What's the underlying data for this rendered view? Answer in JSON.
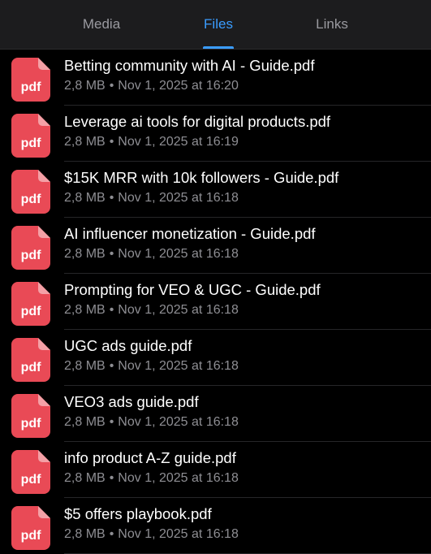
{
  "tabs": [
    {
      "label": "Media",
      "active": false
    },
    {
      "label": "Files",
      "active": true
    },
    {
      "label": "Links",
      "active": false
    }
  ],
  "colors": {
    "accent": "#3a9cff",
    "pdf_icon": "#e94a56",
    "background": "#000000"
  },
  "icon": "pdf-file-icon",
  "pdf_label": "pdf",
  "files": [
    {
      "name": "Betting community with AI - Guide.pdf",
      "size": "2,8 MB",
      "date": "Nov 1, 2025 at 16:20"
    },
    {
      "name": "Leverage ai tools for digital products.pdf",
      "size": "2,8 MB",
      "date": "Nov 1, 2025 at 16:19"
    },
    {
      "name": "$15K MRR with 10k followers - Guide.pdf",
      "size": "2,8 MB",
      "date": "Nov 1, 2025 at 16:18"
    },
    {
      "name": "AI influencer monetization - Guide.pdf",
      "size": "2,8 MB",
      "date": "Nov 1, 2025 at 16:18"
    },
    {
      "name": "Prompting for VEO & UGC - Guide.pdf",
      "size": "2,8 MB",
      "date": "Nov 1, 2025 at 16:18"
    },
    {
      "name": "UGC ads guide.pdf",
      "size": "2,8 MB",
      "date": "Nov 1, 2025 at 16:18"
    },
    {
      "name": "VEO3 ads guide.pdf",
      "size": "2,8 MB",
      "date": "Nov 1, 2025 at 16:18"
    },
    {
      "name": "info product A-Z guide.pdf",
      "size": "2,8 MB",
      "date": "Nov 1, 2025 at 16:18"
    },
    {
      "name": "$5 offers playbook.pdf",
      "size": "2,8 MB",
      "date": "Nov 1, 2025 at 16:18"
    }
  ]
}
